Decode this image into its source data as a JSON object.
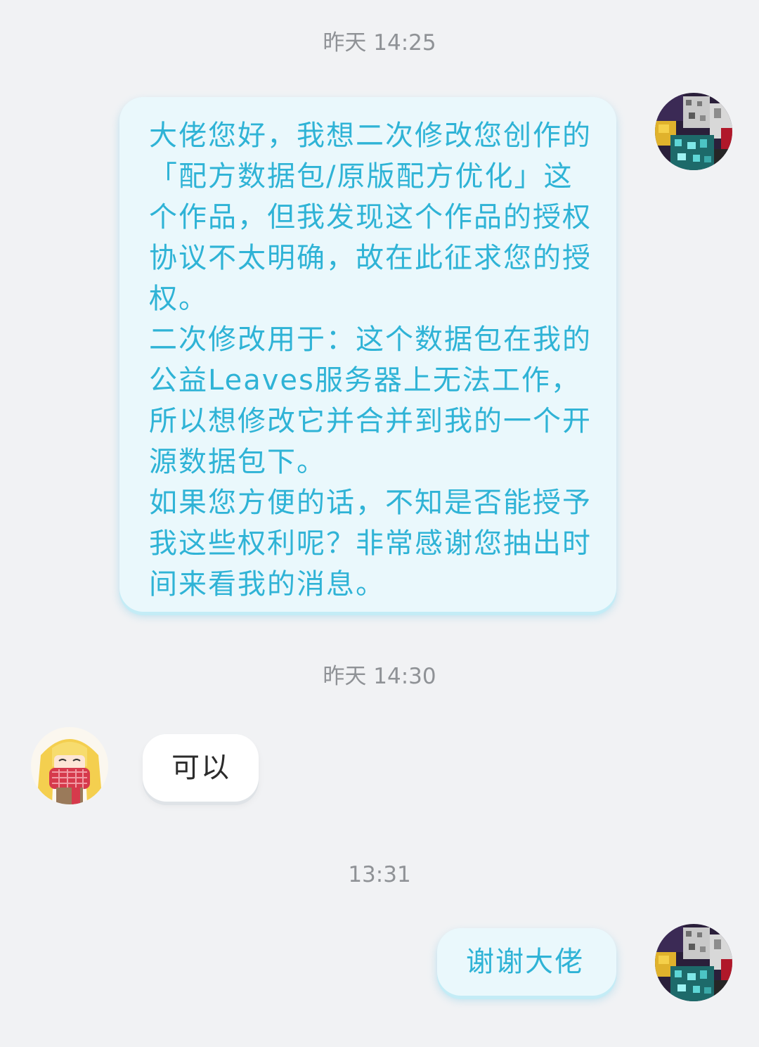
{
  "colors": {
    "background": "#f1f2f4",
    "my_bubble": "#eaf8fc",
    "my_text": "#2fb3d6",
    "other_bubble": "#ffffff",
    "other_text": "#2b2b2b",
    "timestamp_text": "#8f9296"
  },
  "messages": [
    {
      "timestamp": "昨天 14:25",
      "sender": "me",
      "avatar_icon": "minecraft-blocks-avatar-icon",
      "text": "大佬您好，我想二次修改您创作的「配方数据包/原版配方优化」这个作品，但我发现这个作品的授权协议不太明确，故在此征求您的授权。\n二次修改用于：这个数据包在我的公益Leaves服务器上无法工作，所以想修改它并合并到我的一个开源数据包下。\n如果您方便的话，不知是否能授予我这些权利呢？非常感谢您抽出时间来看我的消息。"
    },
    {
      "timestamp": "昨天 14:30",
      "sender": "other",
      "avatar_icon": "anime-girl-scarf-avatar-icon",
      "text": "可以"
    },
    {
      "timestamp": "13:31",
      "sender": "me",
      "avatar_icon": "minecraft-blocks-avatar-icon",
      "text": "谢谢大佬"
    }
  ]
}
